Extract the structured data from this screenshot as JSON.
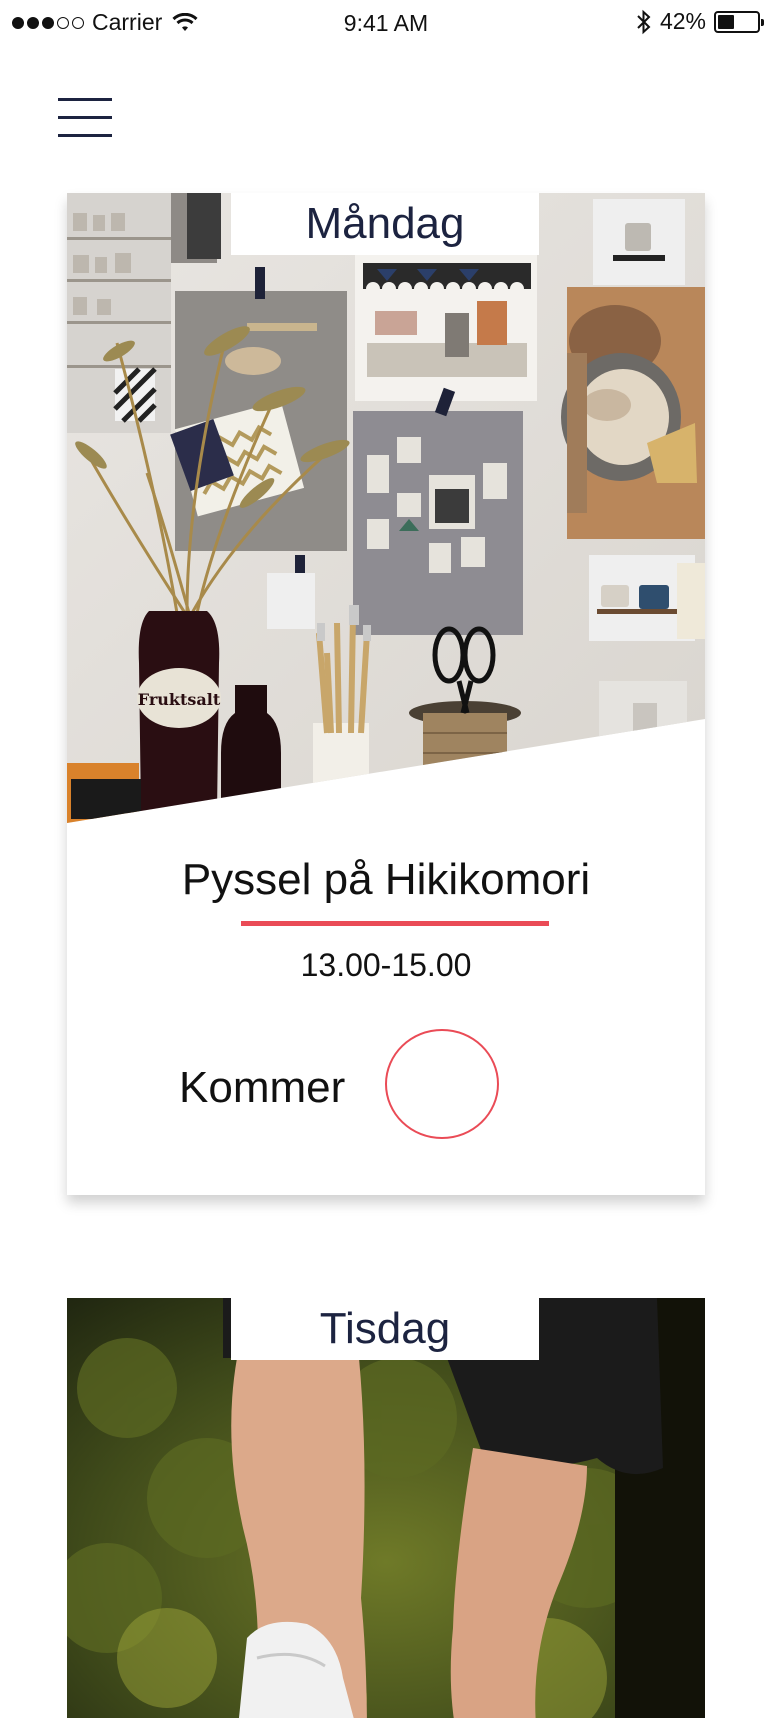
{
  "status_bar": {
    "carrier": "Carrier",
    "time": "9:41 AM",
    "battery": "42%",
    "battery_level": 0.42,
    "signal_bars_filled": 3,
    "signal_bars_total": 5
  },
  "nav": {
    "menu_icon": "hamburger-icon"
  },
  "days": [
    {
      "day": "Måndag",
      "event_title": "Pyssel på Hikikomori",
      "event_time": "13.00-15.00",
      "attend_label": "Kommer",
      "attending": false,
      "image": "craft-studio-photo",
      "bottle_label": "Fruktsalt"
    },
    {
      "day": "Tisdag",
      "image": "running-legs-photo"
    }
  ],
  "colors": {
    "accent": "#ea4b56",
    "navy": "#1c2340",
    "background": "#ffffff"
  }
}
